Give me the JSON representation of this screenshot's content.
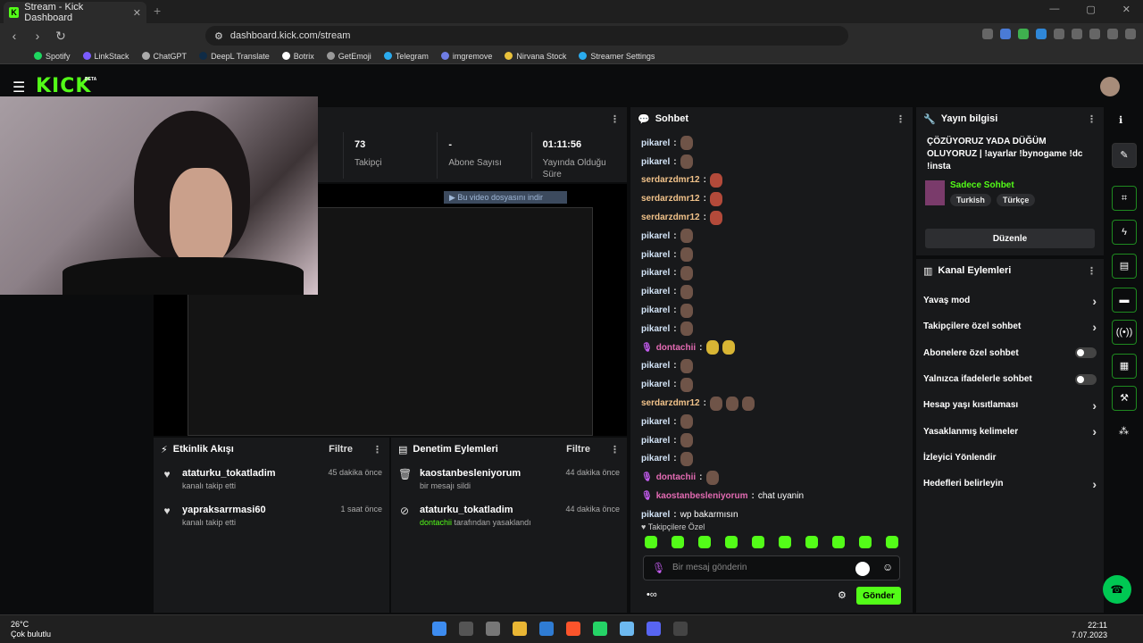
{
  "browser": {
    "tab_title": "Stream - Kick Dashboard",
    "url": "dashboard.kick.com/stream",
    "bookmarks": [
      "Spotify",
      "LinkStack",
      "ChatGPT",
      "DeepL Translate",
      "Botrix",
      "GetEmoji",
      "Telegram",
      "imgremove",
      "Nirvana Stock",
      "Streamer Settings"
    ]
  },
  "header": {
    "logo": "KICK",
    "beta": "BETA"
  },
  "stats": [
    {
      "value": "73",
      "label": "Takipçi"
    },
    {
      "value": "-",
      "label": "Abone Sayısı"
    },
    {
      "value": "01:11:56",
      "label": "Yayında Olduğu Süre"
    }
  ],
  "preview": {
    "download_bar": "Bu video dosyasını indir"
  },
  "activity": {
    "title": "Etkinlik Akışı",
    "filter": "Filtre",
    "items": [
      {
        "name": "ataturku_tokatladim",
        "sub": "kanalı takip etti",
        "time": "45 dakika önce"
      },
      {
        "name": "yapraksarrmasi60",
        "sub": "kanalı takip etti",
        "time": "1 saat önce"
      }
    ]
  },
  "moderation": {
    "title": "Denetim Eylemleri",
    "filter": "Filtre",
    "items": [
      {
        "name": "kaostanbesleniyorum",
        "sub": "bir mesajı sildi",
        "time": "44 dakika önce"
      },
      {
        "name": "ataturku_tokatladim",
        "sub_user": "dontachii",
        "sub": " tarafından yasaklandı",
        "time": "44 dakika önce"
      }
    ]
  },
  "chat": {
    "title": "Sohbet",
    "messages": [
      {
        "user": "pikarel",
        "kind": "blue",
        "emotes": 1
      },
      {
        "user": "pikarel",
        "kind": "blue",
        "emotes": 1
      },
      {
        "user": "serdarzdmr12",
        "kind": "orange",
        "emotes": 1,
        "red": true
      },
      {
        "user": "serdarzdmr12",
        "kind": "orange",
        "emotes": 1,
        "red": true
      },
      {
        "user": "serdarzdmr12",
        "kind": "orange",
        "emotes": 1,
        "red": true
      },
      {
        "user": "pikarel",
        "kind": "blue",
        "emotes": 1
      },
      {
        "user": "pikarel",
        "kind": "blue",
        "emotes": 1
      },
      {
        "user": "pikarel",
        "kind": "blue",
        "emotes": 1
      },
      {
        "user": "pikarel",
        "kind": "blue",
        "emotes": 1
      },
      {
        "user": "pikarel",
        "kind": "blue",
        "emotes": 1
      },
      {
        "user": "pikarel",
        "kind": "blue",
        "emotes": 1
      },
      {
        "user": "dontachii",
        "kind": "pink",
        "emotes": 2,
        "gold": true
      },
      {
        "user": "pikarel",
        "kind": "blue",
        "emotes": 1
      },
      {
        "user": "pikarel",
        "kind": "blue",
        "emotes": 1
      },
      {
        "user": "serdarzdmr12",
        "kind": "orange",
        "emotes": 3
      },
      {
        "user": "pikarel",
        "kind": "blue",
        "emotes": 1
      },
      {
        "user": "pikarel",
        "kind": "blue",
        "emotes": 1
      },
      {
        "user": "pikarel",
        "kind": "blue",
        "emotes": 1
      },
      {
        "user": "dontachii",
        "kind": "pink",
        "emotes": 1
      },
      {
        "user": "kaostanbesleniyorum",
        "kind": "pink",
        "text": "chat uyanin"
      },
      {
        "user": "pikarel",
        "kind": "blue",
        "text": "wp bakarmısın"
      }
    ],
    "followers_only": "Takipçilere Özel",
    "input_placeholder": "Bir mesaj gönderin",
    "send": "Gönder"
  },
  "stream_info": {
    "title": "Yayın bilgisi",
    "stream_title": "ÇÖZÜYORUZ YADA DÜĞÜM OLUYORUZ | !ayarlar !bynogame !dc !insta",
    "category": "Sadece Sohbet",
    "tags": [
      "Turkish",
      "Türkçe"
    ],
    "edit": "Düzenle"
  },
  "channel_actions": {
    "title": "Kanal Eylemleri",
    "items": [
      {
        "label": "Yavaş mod",
        "ctrl": "arrow"
      },
      {
        "label": "Takipçilere özel sohbet",
        "ctrl": "arrow"
      },
      {
        "label": "Abonelere özel sohbet",
        "ctrl": "toggle"
      },
      {
        "label": "Yalnızca ifadelerle sohbet",
        "ctrl": "toggle"
      },
      {
        "label": "Hesap yaşı kısıtlaması",
        "ctrl": "arrow"
      },
      {
        "label": "Yasaklanmış kelimeler",
        "ctrl": "arrow"
      },
      {
        "label": "İzleyici Yönlendir",
        "ctrl": "none"
      },
      {
        "label": "Hedefleri belirleyin",
        "ctrl": "arrow"
      }
    ]
  },
  "taskbar": {
    "temp": "26°C",
    "weather": "Çok bulutlu",
    "time": "22:11",
    "date": "7.07.2023"
  },
  "colors": {
    "accent": "#53fc18",
    "panel": "#18191b",
    "background": "#0b0c0d"
  }
}
